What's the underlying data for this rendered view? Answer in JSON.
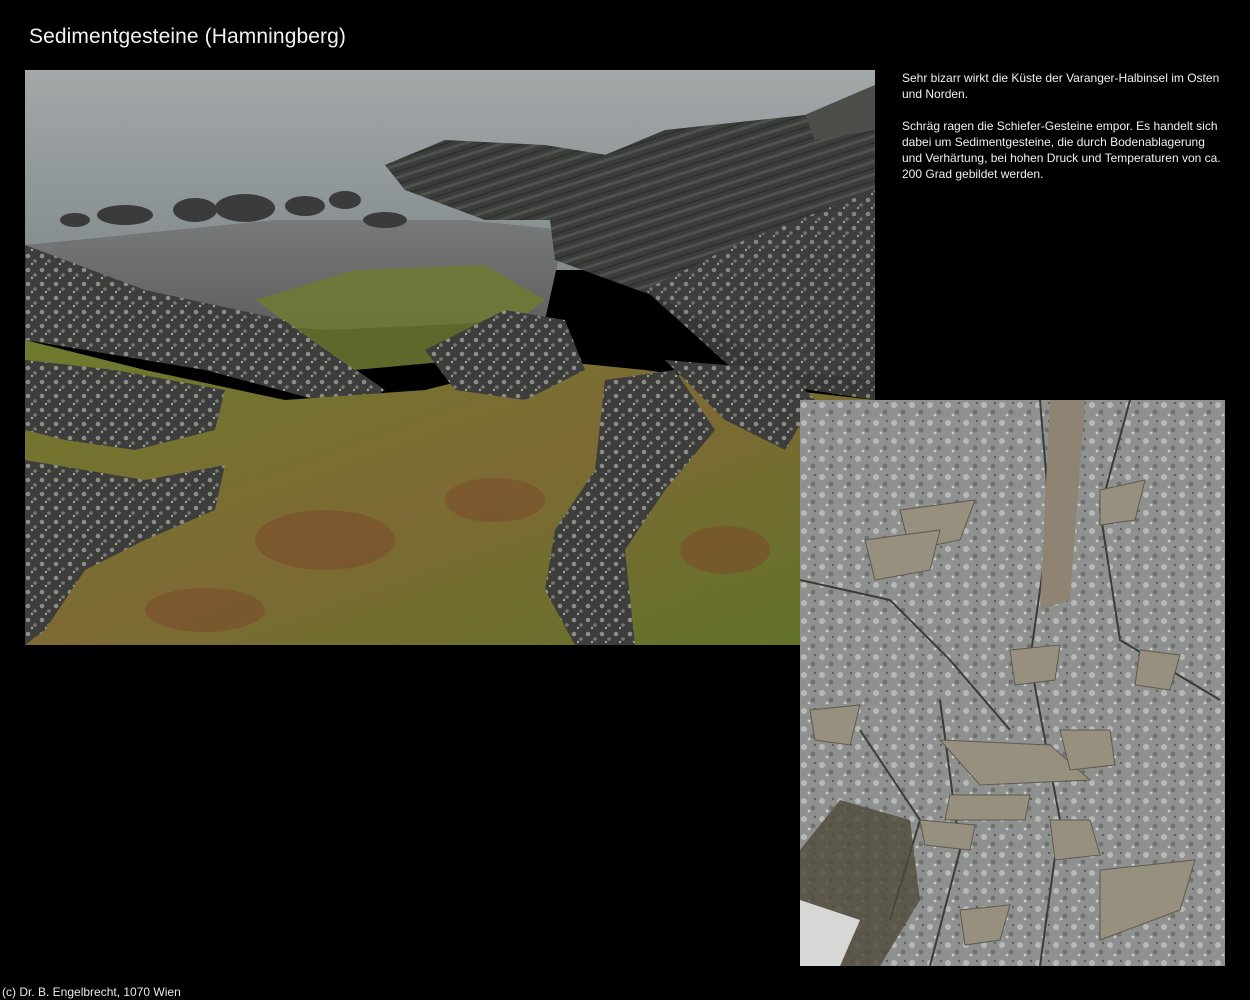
{
  "page": {
    "title": "Sedimentgesteine (Hamningberg)",
    "footer": "(c) Dr. B. Engelbrecht, 1070 Wien"
  },
  "description": {
    "paragraph_1": "Sehr bizarr wirkt die Küste der Varanger-Halbinsel im Osten und Norden.",
    "paragraph_2": "Schräg ragen die Schiefer-Gesteine empor. Es handelt sich dabei um Sedimentgesteine, die durch Bodenablagerung und Verhärtung, bei hohen Druck und Temperaturen von ca. 200 Grad gebildet werden."
  },
  "photos": [
    {
      "subject": "coastline-with-slanted-rock-strata"
    },
    {
      "subject": "close-up-of-slate-fragments"
    }
  ],
  "colors": {
    "background": "#000000",
    "text": "#f0f0f0",
    "sea": "#8d9597",
    "moss": "#7f8a34",
    "rock": "#4a4b4a",
    "lichen_rock": "#9a9c9b",
    "slate": "#8f8a7c"
  }
}
